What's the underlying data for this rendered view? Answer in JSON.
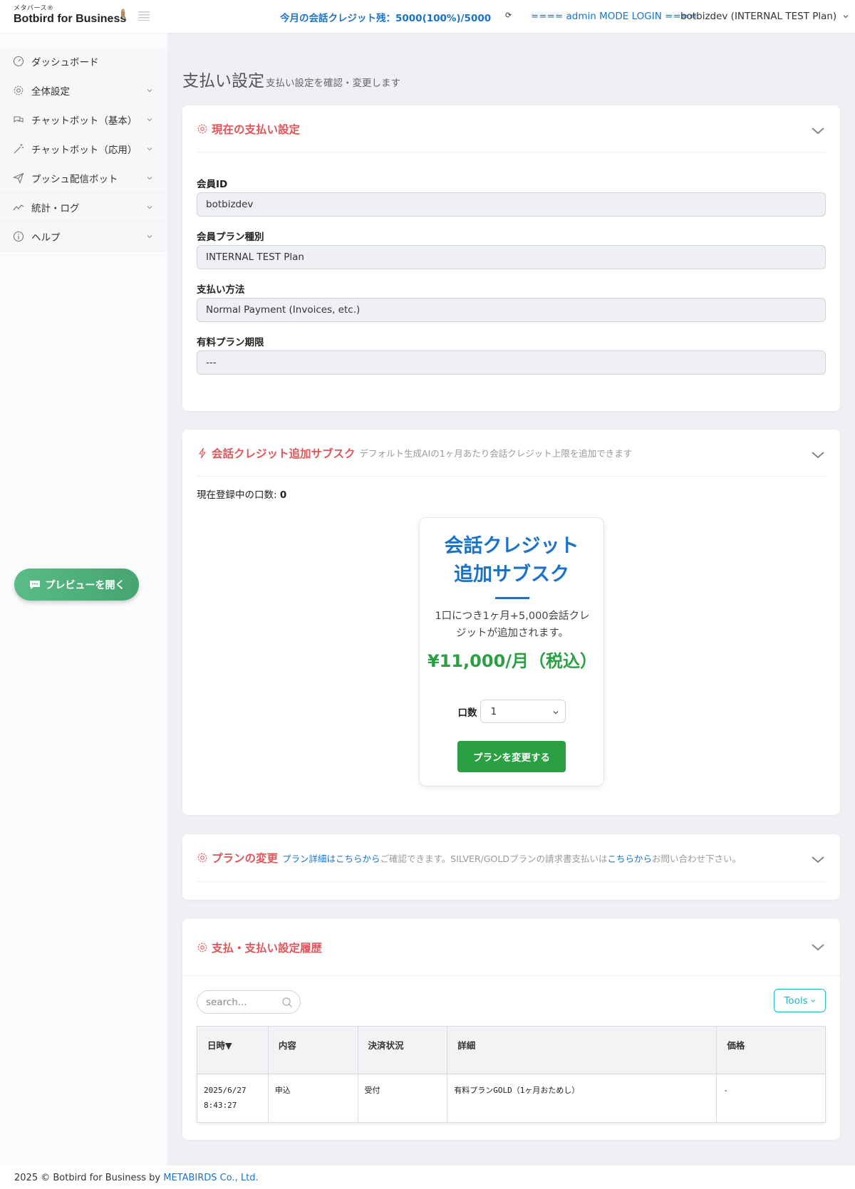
{
  "header": {
    "logo_small": "メタバース®",
    "logo_main": "Botbird for Business",
    "credit": "今月の会話クレジット残：5000(100%)/5000",
    "admin": "==== admin MODE LOGIN ====",
    "account": "botbizdev (INTERNAL TEST Plan)"
  },
  "sidebar": {
    "items": [
      {
        "label": "ダッシュボード",
        "icon": "dashboard-icon"
      },
      {
        "label": "全体設定",
        "icon": "gear-icon"
      },
      {
        "label": "チャットボット（基本）",
        "icon": "chat-bubbles-icon"
      },
      {
        "label": "チャットボット（応用）",
        "icon": "magic-wand-icon"
      },
      {
        "label": "プッシュ配信ボット",
        "icon": "paper-plane-icon"
      },
      {
        "label": "統計・ログ",
        "icon": "line-chart-icon"
      },
      {
        "label": "ヘルプ",
        "icon": "info-icon"
      }
    ],
    "preview_label": "プレビューを開く"
  },
  "page": {
    "title": "支払い設定",
    "subtitle": "支払い設定を確認・変更します"
  },
  "current_settings": {
    "heading": "現在の支払い設定",
    "fields": [
      {
        "label": "会員ID",
        "value": "botbizdev"
      },
      {
        "label": "会員プラン種別",
        "value": "INTERNAL TEST Plan"
      },
      {
        "label": "支払い方法",
        "value": "Normal Payment (Invoices, etc.)"
      },
      {
        "label": "有料プラン期限",
        "value": "---"
      }
    ]
  },
  "credit_subscription": {
    "heading": "会話クレジット追加サブスク",
    "description": "デフォルト生成AIの1ヶ月あたり会話クレジット上限を追加できます",
    "count_label": "現在登録中の口数: ",
    "count_value": "0",
    "plan_title_line1": "会話クレジット",
    "plan_title_line2": "追加サブスク",
    "plan_desc": "1口につき1ヶ月+5,000会話クレジットが追加されます。",
    "plan_price": "¥11,000/月（税込）",
    "qty_label": "口数",
    "qty_value": "1",
    "change_button": "プランを変更する"
  },
  "plan_change": {
    "heading": "プランの変更",
    "link1": "プラン詳細はこちらから",
    "text1": "ご確認できます。SILVER/GOLDプランの請求書支払いは",
    "link2": "こちらから",
    "text2": "お問い合わせ下さい。"
  },
  "history": {
    "heading": "支払・支払い設定履歴",
    "search_placeholder": "search...",
    "tools_label": "Tools",
    "columns": [
      "日時▼",
      "内容",
      "決済状況",
      "詳細",
      "価格"
    ],
    "rows": [
      {
        "date_line1": "2025/6/27",
        "date_line2": "8:43:27",
        "content": "申込",
        "status": "受付",
        "detail": "有料プランGOLD（1ヶ月おためし）",
        "price": "-"
      }
    ]
  },
  "footer": {
    "text": "2025 © Botbird for Business by ",
    "link": "METABIRDS Co., Ltd."
  },
  "colors": {
    "accent_blue": "#1a73c8",
    "heading_red": "#e0555a",
    "green": "#2aa043",
    "teal": "#1fb6c9"
  }
}
